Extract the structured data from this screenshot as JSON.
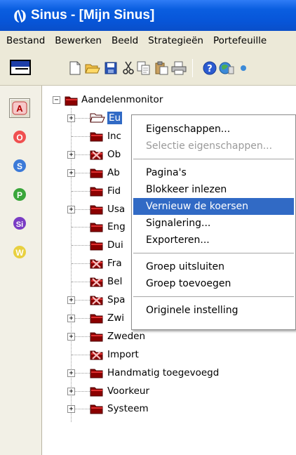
{
  "window": {
    "title": "Sinus - [Mijn Sinus]"
  },
  "menubar": {
    "items": [
      "Bestand",
      "Bewerken",
      "Beeld",
      "Strategieën",
      "Portefeuille"
    ]
  },
  "sidebar": {
    "buttons": [
      "A",
      "O",
      "S",
      "P",
      "Si",
      "W"
    ]
  },
  "tree": {
    "root": "Aandelenmonitor",
    "nodes": [
      {
        "label": "Europa",
        "visible_text": "Eu",
        "expandable": true,
        "selected": true
      },
      {
        "label": "Inc",
        "expandable": false
      },
      {
        "label": "Ob",
        "expandable": true,
        "crossed": true
      },
      {
        "label": "Ab",
        "expandable": true
      },
      {
        "label": "Fid",
        "expandable": false
      },
      {
        "label": "Usa",
        "expandable": true
      },
      {
        "label": "Eng",
        "expandable": false
      },
      {
        "label": "Dui",
        "expandable": false
      },
      {
        "label": "Fra",
        "expandable": false,
        "crossed": true
      },
      {
        "label": "Bel",
        "expandable": false,
        "crossed": true
      },
      {
        "label": "Spa",
        "expandable": true,
        "crossed": true
      },
      {
        "label": "Zwi",
        "expandable": true
      },
      {
        "label": "Zweden",
        "expandable": true
      },
      {
        "label": "Import",
        "expandable": false,
        "crossed": true
      },
      {
        "label": "Handmatig toegevoegd",
        "expandable": true
      },
      {
        "label": "Voorkeur",
        "expandable": true
      },
      {
        "label": "Systeem",
        "expandable": true
      }
    ]
  },
  "context_menu": {
    "items": [
      {
        "label": "Eigenschappen...",
        "state": "enabled"
      },
      {
        "label": "Selectie eigenschappen...",
        "state": "disabled"
      },
      {
        "label": "Pagina's",
        "state": "enabled"
      },
      {
        "label": "Blokkeer inlezen",
        "state": "enabled"
      },
      {
        "label": "Vernieuw de koersen",
        "state": "highlighted"
      },
      {
        "label": "Signalering...",
        "state": "enabled"
      },
      {
        "label": "Exporteren...",
        "state": "enabled"
      },
      {
        "label": "Groep uitsluiten",
        "state": "enabled"
      },
      {
        "label": "Groep toevoegen",
        "state": "enabled"
      },
      {
        "label": "Originele instelling",
        "state": "enabled"
      }
    ]
  },
  "colors": {
    "titlebar": "#0a5ee0",
    "selection": "#316ac5",
    "folder": "#8b0000"
  }
}
